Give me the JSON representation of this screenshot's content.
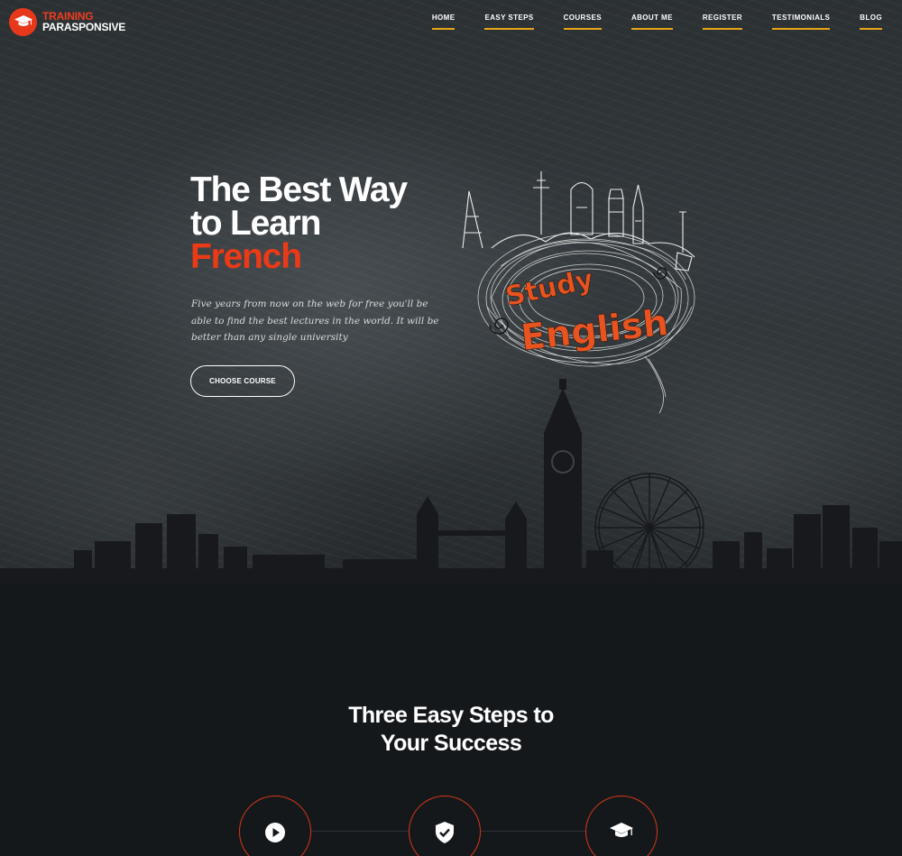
{
  "brand": {
    "name_line1": "TRAINING",
    "name_line2": "PARASPONSIVE",
    "icon": "graduation-cap-icon",
    "accent_color": "#e8381c"
  },
  "nav": {
    "items": [
      {
        "label": "HOME"
      },
      {
        "label": "EASY STEPS"
      },
      {
        "label": "COURSES"
      },
      {
        "label": "ABOUT ME"
      },
      {
        "label": "REGISTER"
      },
      {
        "label": "TESTIMONIALS"
      },
      {
        "label": "BLOG"
      }
    ],
    "underline_color": "#e8a418"
  },
  "hero": {
    "headline_line1": "The Best Way",
    "headline_line2": "to Learn",
    "headline_accent": "French",
    "tagline": "Five years from now on the web for free you'll be able to find the best lectures in the world. It will be better than any single university",
    "cta_label": "CHOOSE COURSE",
    "illustration_text1": "Study",
    "illustration_text2": "English"
  },
  "steps": {
    "title_line1": "Three Easy Steps to",
    "title_line2": "Your Success",
    "icons": [
      "play-icon",
      "shield-check-icon",
      "graduation-cap-icon"
    ],
    "circle_color": "#d8361a"
  }
}
